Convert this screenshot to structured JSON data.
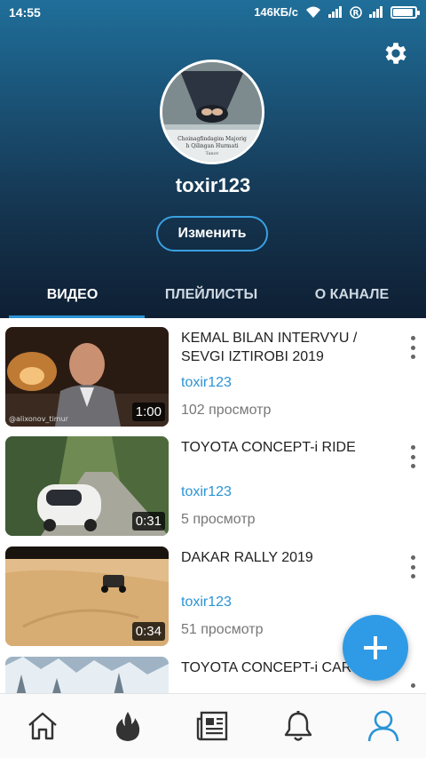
{
  "status_bar": {
    "time": "14:55",
    "speed": "146КБ/с",
    "icons": [
      "wifi-icon",
      "signal-icon",
      "roaming-icon",
      "signal-icon",
      "battery-icon"
    ],
    "battery_level": 0.9
  },
  "profile": {
    "avatar_caption_lines": [
      "Choinagfindagim Majorig",
      "h Qilingan Hurmati",
      "Tanov"
    ],
    "username": "toxir123",
    "edit_label": "Изменить",
    "settings_icon": "gear-icon"
  },
  "tabs": [
    {
      "label": "ВИДЕО",
      "active": true
    },
    {
      "label": "ПЛЕЙЛИСТЫ",
      "active": false
    },
    {
      "label": "О КАНАЛЕ",
      "active": false
    }
  ],
  "videos": [
    {
      "title": "KEMAL BILAN INTERVYU / SEVGI IZTIROBI 2019",
      "channel": "toxir123",
      "views": "102 просмотр",
      "duration": "1:00",
      "watermark": "@alixonov_timur"
    },
    {
      "title": "TOYOTA CONCEPT-i RIDE",
      "channel": "toxir123",
      "views": "5 просмотр",
      "duration": "0:31"
    },
    {
      "title": "DAKAR RALLY 2019",
      "channel": "toxir123",
      "views": "51 просмотр",
      "duration": "0:34"
    },
    {
      "title": "TOYOTA CONCEPT-i CAR",
      "channel": "",
      "views": "",
      "duration": ""
    }
  ],
  "fab": {
    "icon": "plus-icon"
  },
  "bottom_nav": [
    {
      "icon": "home-icon",
      "active": false
    },
    {
      "icon": "fire-icon",
      "active": false
    },
    {
      "icon": "news-icon",
      "active": false
    },
    {
      "icon": "bell-icon",
      "active": false
    },
    {
      "icon": "profile-icon",
      "active": true
    }
  ],
  "colors": {
    "accent": "#2b94d6",
    "fab": "#2f9be6",
    "header_top": "#1f6f9a",
    "header_bottom": "#0e1f33"
  }
}
